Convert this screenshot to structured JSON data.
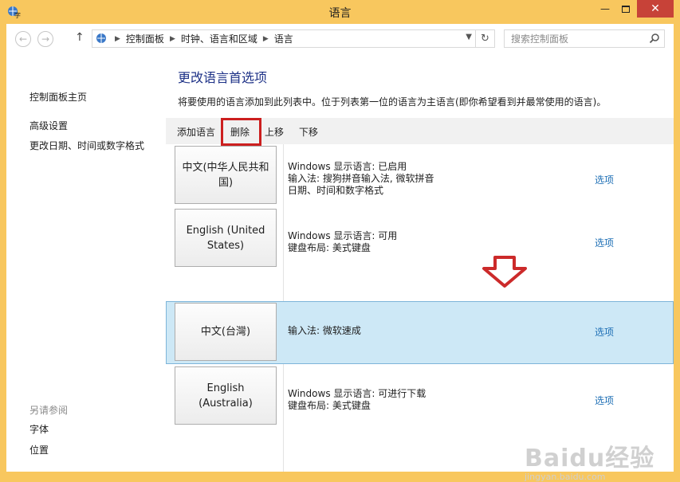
{
  "window": {
    "title": "语言",
    "close_glyph": "✕",
    "minimize_glyph": "—"
  },
  "nav": {
    "breadcrumb": [
      "控制面板",
      "时钟、语言和区域",
      "语言"
    ],
    "search_placeholder": "搜索控制面板"
  },
  "sidebar": {
    "home": "控制面板主页",
    "links": [
      "高级设置",
      "更改日期、时间或数字格式"
    ],
    "see_also_title": "另请参阅",
    "see_also_links": [
      "字体",
      "位置"
    ]
  },
  "main": {
    "heading": "更改语言首选项",
    "description": "将要使用的语言添加到此列表中。位于列表第一位的语言为主语言(即你希望看到并最常使用的语言)。"
  },
  "toolbar": {
    "add_label": "添加语言",
    "delete_label": "删除",
    "up_label": "上移",
    "down_label": "下移"
  },
  "languages": [
    {
      "name": "中文(中华人民共和国)",
      "details": [
        "Windows 显示语言: 已启用",
        "输入法: 搜狗拼音输入法, 微软拼音",
        "日期、时间和数字格式"
      ],
      "options_label": "选项"
    },
    {
      "name": "English (United States)",
      "details": [
        "Windows 显示语言: 可用",
        "键盘布局: 美式键盘"
      ],
      "options_label": "选项"
    },
    {
      "name": "中文(台灣)",
      "details": [
        "输入法: 微软速成"
      ],
      "options_label": "选项",
      "selected": true
    },
    {
      "name": "English (Australia)",
      "details": [
        "Windows 显示语言: 可进行下载",
        "键盘布局: 美式键盘"
      ],
      "options_label": "选项"
    }
  ],
  "watermark": {
    "logo": "Baidu经验",
    "url": "jingyan.baidu.com"
  },
  "colors": {
    "frame": "#f8c75e",
    "heading": "#1e3287",
    "link": "#1e6fb5",
    "selected_row": "#cde8f6",
    "highlight_red": "#cc1f1f",
    "close_button": "#c74238"
  }
}
